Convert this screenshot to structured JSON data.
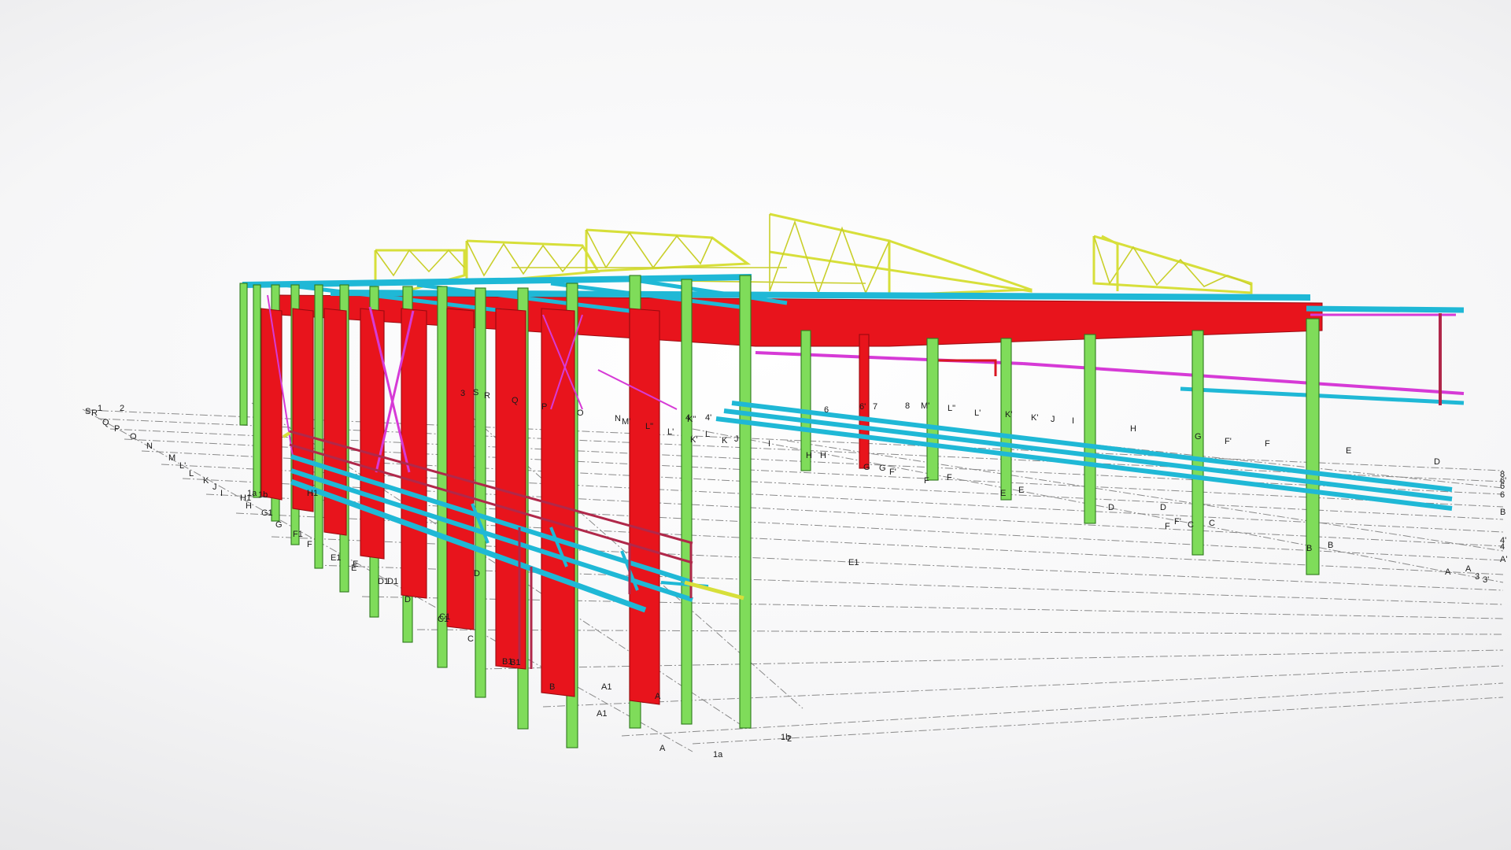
{
  "grid_labels": {
    "front_left": [
      "S",
      "R",
      "1",
      "2",
      "Q",
      "P",
      "O",
      "N",
      "M",
      "L'",
      "L",
      "K",
      "J",
      "I",
      "1a",
      "1b",
      "H1",
      "H",
      "H1",
      "G1",
      "G",
      "F1",
      "F",
      "E1",
      "E",
      "D1",
      "D",
      "C1",
      "C",
      "B1",
      "B",
      "A1",
      "A",
      "A",
      "1a",
      "1b",
      "2"
    ],
    "inner_col": [
      "3",
      "S",
      "R",
      "Q",
      "P",
      "O",
      "N",
      "M'",
      "L\"",
      "4",
      "L'",
      "K\"",
      "L",
      "K'",
      "K",
      "J",
      "I",
      "H",
      "H",
      "G",
      "F'",
      "F",
      "E1",
      "E",
      "D1",
      "D",
      "C1",
      "B1",
      "A1"
    ],
    "back_row": [
      "4'",
      "6",
      "6'",
      "7",
      "8",
      "M'",
      "L\"",
      "L'",
      "K'",
      "K'",
      "J",
      "I",
      "H",
      "G",
      "G",
      "F'",
      "F",
      "F",
      "E",
      "E",
      "D",
      "D",
      "C",
      "C",
      "B",
      "B",
      "E",
      "D",
      "F'",
      "F"
    ],
    "right_edge": [
      "8",
      "6'",
      "6",
      "6",
      "B",
      "4'",
      "4",
      "A'",
      "A",
      "A",
      "3",
      "3'"
    ]
  },
  "colors": {
    "column_primary": "#e8141c",
    "column_secondary": "#7fdc5a",
    "beam_primary": "#1fb8d6",
    "beam_bracing": "#d63ad6",
    "beam_secondary": "#b0284a",
    "truss": "#d7df3a",
    "grid": "#8a8a8a",
    "background": "#f2f2f3"
  }
}
